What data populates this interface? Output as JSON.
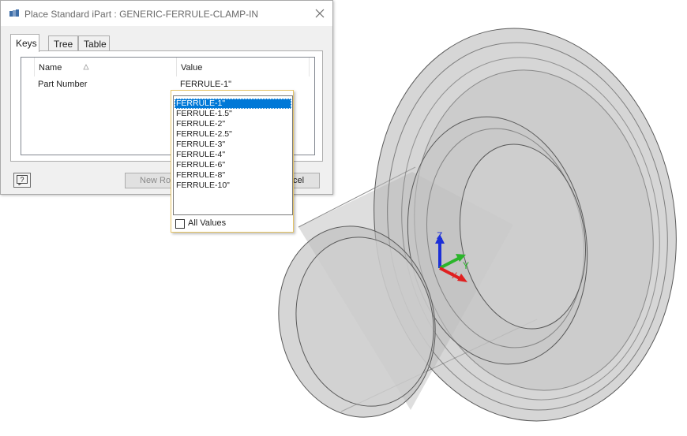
{
  "dialog": {
    "title": "Place Standard iPart : GENERIC-FERRULE-CLAMP-IN",
    "tabs": [
      {
        "label": "Keys",
        "active": true
      },
      {
        "label": "Tree",
        "active": false
      },
      {
        "label": "Table",
        "active": false
      }
    ],
    "grid": {
      "columns": [
        "Name",
        "Value"
      ],
      "rows": [
        {
          "name": "Part Number",
          "value": "FERRULE-1\""
        }
      ]
    },
    "buttons": {
      "new_row": "New Row",
      "cancel": "Cancel"
    }
  },
  "dropdown": {
    "options": [
      "FERRULE-1\"",
      "FERRULE-1.5\"",
      "FERRULE-2\"",
      "FERRULE-2.5\"",
      "FERRULE-3\"",
      "FERRULE-4\"",
      "FERRULE-6\"",
      "FERRULE-8\"",
      "FERRULE-10\""
    ],
    "selected": "FERRULE-1\"",
    "all_values_label": "All Values",
    "all_values_checked": false
  },
  "viewport": {
    "axis_labels": {
      "x": "X",
      "y": "Y",
      "z": "Z"
    }
  },
  "colors": {
    "selection": "#0078d7",
    "axis_x": "#e02020",
    "axis_y": "#2bb52b",
    "axis_z": "#1c2fd8",
    "model_fill": "#b9b9b9",
    "model_edge": "#5a5a5a",
    "dropdown_border": "#e5c365"
  }
}
